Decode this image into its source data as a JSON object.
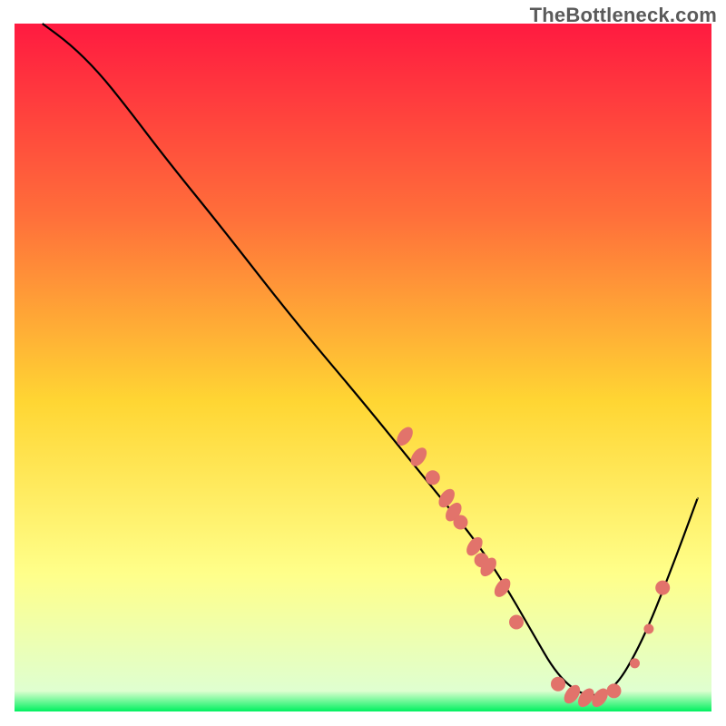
{
  "watermark": "TheBottleneck.com",
  "chart_data": {
    "type": "line",
    "title": "",
    "xlabel": "",
    "ylabel": "",
    "xlim": [
      0,
      100
    ],
    "ylim": [
      0,
      100
    ],
    "grid": false,
    "legend": false,
    "background_gradient": {
      "top_color": "#ff1a40",
      "mid_upper_color": "#ff6f3a",
      "mid_color": "#ffd633",
      "mid_lower_color": "#ffff8a",
      "bottom_color": "#00f060"
    },
    "series": [
      {
        "name": "bottleneck-curve",
        "x": [
          4,
          8,
          12,
          16,
          22,
          30,
          40,
          50,
          58,
          62,
          66,
          70,
          74,
          78,
          82,
          86,
          90,
          94,
          98
        ],
        "y": [
          100,
          97,
          93,
          88,
          80,
          70,
          57,
          45,
          35,
          30,
          25,
          19,
          12,
          5,
          2,
          3,
          10,
          20,
          31
        ]
      }
    ],
    "markers": {
      "name": "highlight-points",
      "color": "#e2736b",
      "points": [
        {
          "x": 56,
          "y": 40,
          "shape": "elong"
        },
        {
          "x": 58,
          "y": 37,
          "shape": "elong"
        },
        {
          "x": 60,
          "y": 34,
          "shape": "round"
        },
        {
          "x": 62,
          "y": 31,
          "shape": "elong"
        },
        {
          "x": 63,
          "y": 29,
          "shape": "elong"
        },
        {
          "x": 64,
          "y": 27.5,
          "shape": "round"
        },
        {
          "x": 66,
          "y": 24,
          "shape": "elong"
        },
        {
          "x": 67,
          "y": 22,
          "shape": "round"
        },
        {
          "x": 68,
          "y": 21,
          "shape": "elong"
        },
        {
          "x": 70,
          "y": 18,
          "shape": "elong"
        },
        {
          "x": 72,
          "y": 13,
          "shape": "round"
        },
        {
          "x": 78,
          "y": 4,
          "shape": "round"
        },
        {
          "x": 80,
          "y": 2.5,
          "shape": "elong"
        },
        {
          "x": 82,
          "y": 2,
          "shape": "elong"
        },
        {
          "x": 84,
          "y": 2,
          "shape": "elong"
        },
        {
          "x": 86,
          "y": 3,
          "shape": "round"
        },
        {
          "x": 89,
          "y": 7,
          "shape": "round-sm"
        },
        {
          "x": 91,
          "y": 12,
          "shape": "round-sm"
        },
        {
          "x": 93,
          "y": 18,
          "shape": "round"
        }
      ]
    }
  }
}
